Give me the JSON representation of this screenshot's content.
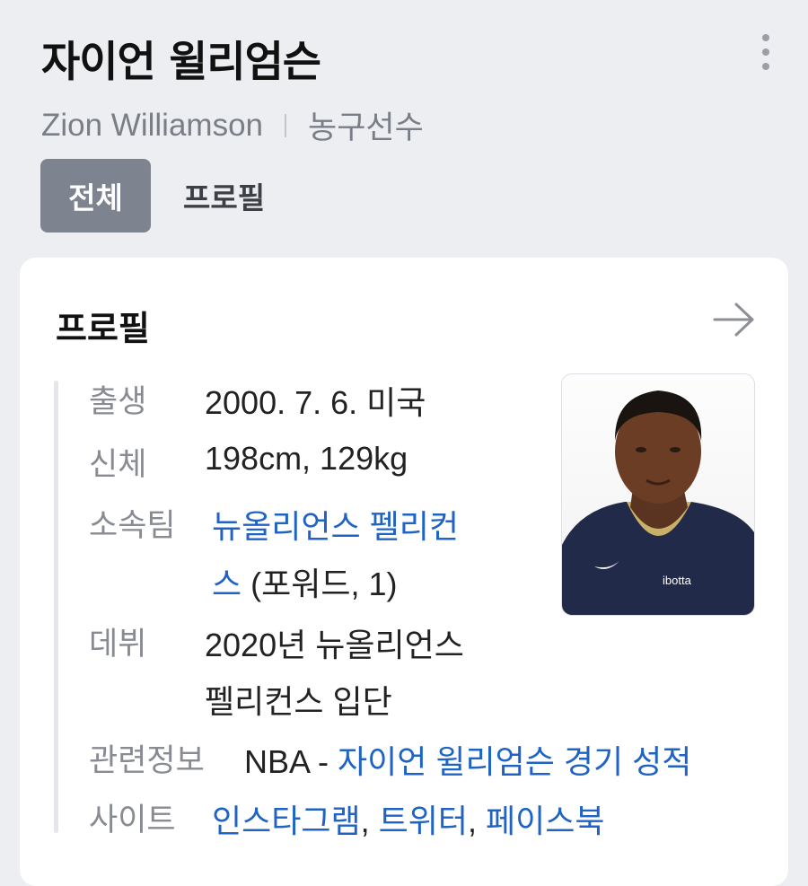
{
  "header": {
    "title": "자이언 윌리엄슨",
    "name_en": "Zion Williamson",
    "category": "농구선수",
    "more_icon": "more-vertical-icon"
  },
  "tabs": [
    {
      "label": "전체",
      "active": true
    },
    {
      "label": "프로필",
      "active": false
    }
  ],
  "profile": {
    "title": "프로필",
    "arrow_icon": "arrow-right-icon",
    "photo_alt": "",
    "rows": {
      "birth": {
        "label": "출생",
        "value": "2000. 7. 6. 미국"
      },
      "body": {
        "label": "신체",
        "value": "198cm, 129kg"
      },
      "team": {
        "label": "소속팀",
        "link_line1": "뉴올리언스 펠리컨",
        "link_line2": "스",
        "extra": " (포워드, 1)"
      },
      "debut": {
        "label": "데뷔",
        "line1": "2020년 뉴올리언스",
        "line2": "펠리컨스 입단"
      },
      "related": {
        "label": "관련정보",
        "prefix": "NBA - ",
        "link": "자이언 윌리엄슨 경기 성적"
      },
      "sites": {
        "label": "사이트",
        "links": [
          "인스타그램",
          "트위터",
          "페이스북"
        ],
        "separator": ", "
      }
    }
  },
  "colors": {
    "link": "#1f63c4",
    "background": "#eceef2",
    "tab_active": "#7d848f"
  }
}
